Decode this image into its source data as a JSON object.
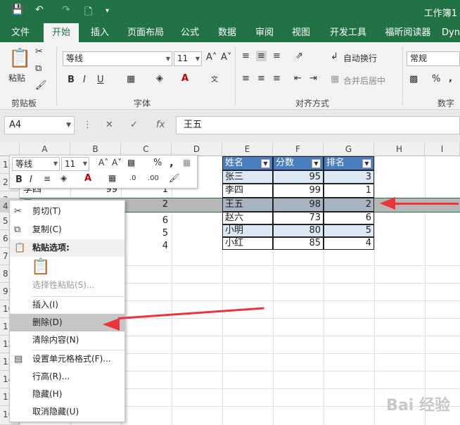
{
  "app": {
    "window_title": "工作簿1"
  },
  "ribbon_tabs": [
    "文件",
    "开始",
    "插入",
    "页面布局",
    "公式",
    "数据",
    "审阅",
    "视图",
    "开发工具",
    "福昕阅读器",
    "Dyn"
  ],
  "ribbon": {
    "clipboard": {
      "paste": "粘贴",
      "label": "剪贴板"
    },
    "font": {
      "name": "等线",
      "size": "11",
      "label": "字体",
      "bold": "B",
      "italic": "I",
      "underline": "U",
      "grow": "A˄",
      "shrink": "A˅"
    },
    "align": {
      "wrap": "自动换行",
      "merge": "合并后居中",
      "label": "对齐方式"
    },
    "number": {
      "format": "常规",
      "label": "数字"
    }
  },
  "formula_bar": {
    "name_box": "A4",
    "fx": "fx",
    "value": "王五"
  },
  "columns": [
    "A",
    "B",
    "C",
    "D",
    "E",
    "F",
    "G",
    "H",
    "I"
  ],
  "rows": [
    "1",
    "2",
    "3",
    "4",
    "5",
    "6",
    "7",
    "8",
    "9",
    "10",
    "11",
    "12",
    "13",
    "14",
    "15",
    "16"
  ],
  "partial_cells": {
    "b3": "99",
    "c3": "1",
    "a3": "李四",
    "a4": "王五",
    "b4": "98",
    "c4": "2",
    "c5": "6",
    "c6": "5",
    "c7": "4"
  },
  "table": {
    "headers": [
      "姓名",
      "分数",
      "排名"
    ],
    "rows": [
      [
        "张三",
        "95",
        "3"
      ],
      [
        "李四",
        "99",
        "1"
      ],
      [
        "王五",
        "98",
        "2"
      ],
      [
        "赵六",
        "73",
        "6"
      ],
      [
        "小明",
        "80",
        "5"
      ],
      [
        "小红",
        "85",
        "4"
      ]
    ]
  },
  "mini_toolbar": {
    "font": "等线",
    "size": "11",
    "percent": "%",
    "comma": ",",
    "bold": "B",
    "italic": "I"
  },
  "context_menu": {
    "cut": "剪切(T)",
    "copy": "复制(C)",
    "paste_options": "粘贴选项:",
    "paste_special": "选择性粘贴(S)...",
    "insert": "插入(I)",
    "delete": "删除(D)",
    "clear": "清除内容(N)",
    "format_cells": "设置单元格格式(F)...",
    "row_height": "行高(R)...",
    "hide": "隐藏(H)",
    "unhide": "取消隐藏(U)"
  },
  "watermark": "Bai 经验",
  "colors": {
    "excel_green": "#217346",
    "table_header": "#4a7fbf",
    "band": "#dde8f5",
    "arrow": "#e8363b",
    "highlight": "#c6c6c6"
  }
}
